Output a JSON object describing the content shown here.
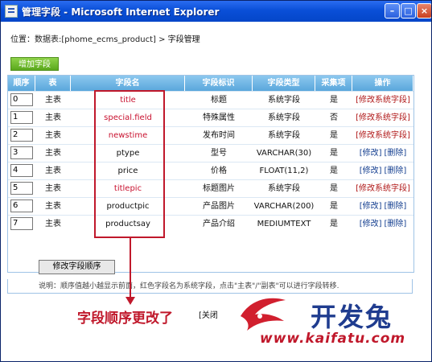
{
  "window": {
    "title": "管理字段 - Microsoft Internet Explorer"
  },
  "breadcrumb": {
    "prefix": "位置：数据表:[phome_ecms_product] > ",
    "current": "字段管理"
  },
  "toolbar": {
    "add_label": "增加字段"
  },
  "table": {
    "headers": [
      "顺序",
      "表",
      "字段名",
      "字段标识",
      "字段类型",
      "采集项",
      "操作"
    ],
    "rows": [
      {
        "order": "0",
        "table": "主表",
        "name": "title",
        "label": "标题",
        "type": "系统字段",
        "collect": "是",
        "op": "[修改系统字段]",
        "system": true
      },
      {
        "order": "1",
        "table": "主表",
        "name": "special.field",
        "label": "特殊属性",
        "type": "系统字段",
        "collect": "否",
        "op": "[修改系统字段]",
        "system": true
      },
      {
        "order": "2",
        "table": "主表",
        "name": "newstime",
        "label": "发布时间",
        "type": "系统字段",
        "collect": "是",
        "op": "[修改系统字段]",
        "system": true
      },
      {
        "order": "3",
        "table": "主表",
        "name": "ptype",
        "label": "型号",
        "type": "VARCHAR(30)",
        "collect": "是",
        "op_edit": "[修改]",
        "op_delete": "[删除]",
        "system": false
      },
      {
        "order": "4",
        "table": "主表",
        "name": "price",
        "label": "价格",
        "type": "FLOAT(11,2)",
        "collect": "是",
        "op_edit": "[修改]",
        "op_delete": "[删除]",
        "system": false
      },
      {
        "order": "5",
        "table": "主表",
        "name": "titlepic",
        "label": "标题图片",
        "type": "系统字段",
        "collect": "是",
        "op": "[修改系统字段]",
        "system": true
      },
      {
        "order": "6",
        "table": "主表",
        "name": "productpic",
        "label": "产品图片",
        "type": "VARCHAR(200)",
        "collect": "是",
        "op_edit": "[修改]",
        "op_delete": "[删除]",
        "system": false
      },
      {
        "order": "7",
        "table": "主表",
        "name": "productsay",
        "label": "产品介绍",
        "type": "MEDIUMTEXT",
        "collect": "是",
        "op_edit": "[修改]",
        "op_delete": "[删除]",
        "system": false
      }
    ],
    "modify_order_label": "修改字段顺序",
    "note": "说明：顺序值越小越显示前面，红色字段名为系统字段，点击\"主表\"/\"副表\"可以进行字段转移."
  },
  "footer": {
    "close_label": "[关闭"
  },
  "annotation": {
    "text": "字段顺序更改了"
  },
  "watermark": {
    "title": "开发兔",
    "url": "www.kaifatu.com"
  },
  "colors": {
    "system_field": "#c8102e",
    "header": "#6bb6e6",
    "annotation": "#c0182b"
  }
}
